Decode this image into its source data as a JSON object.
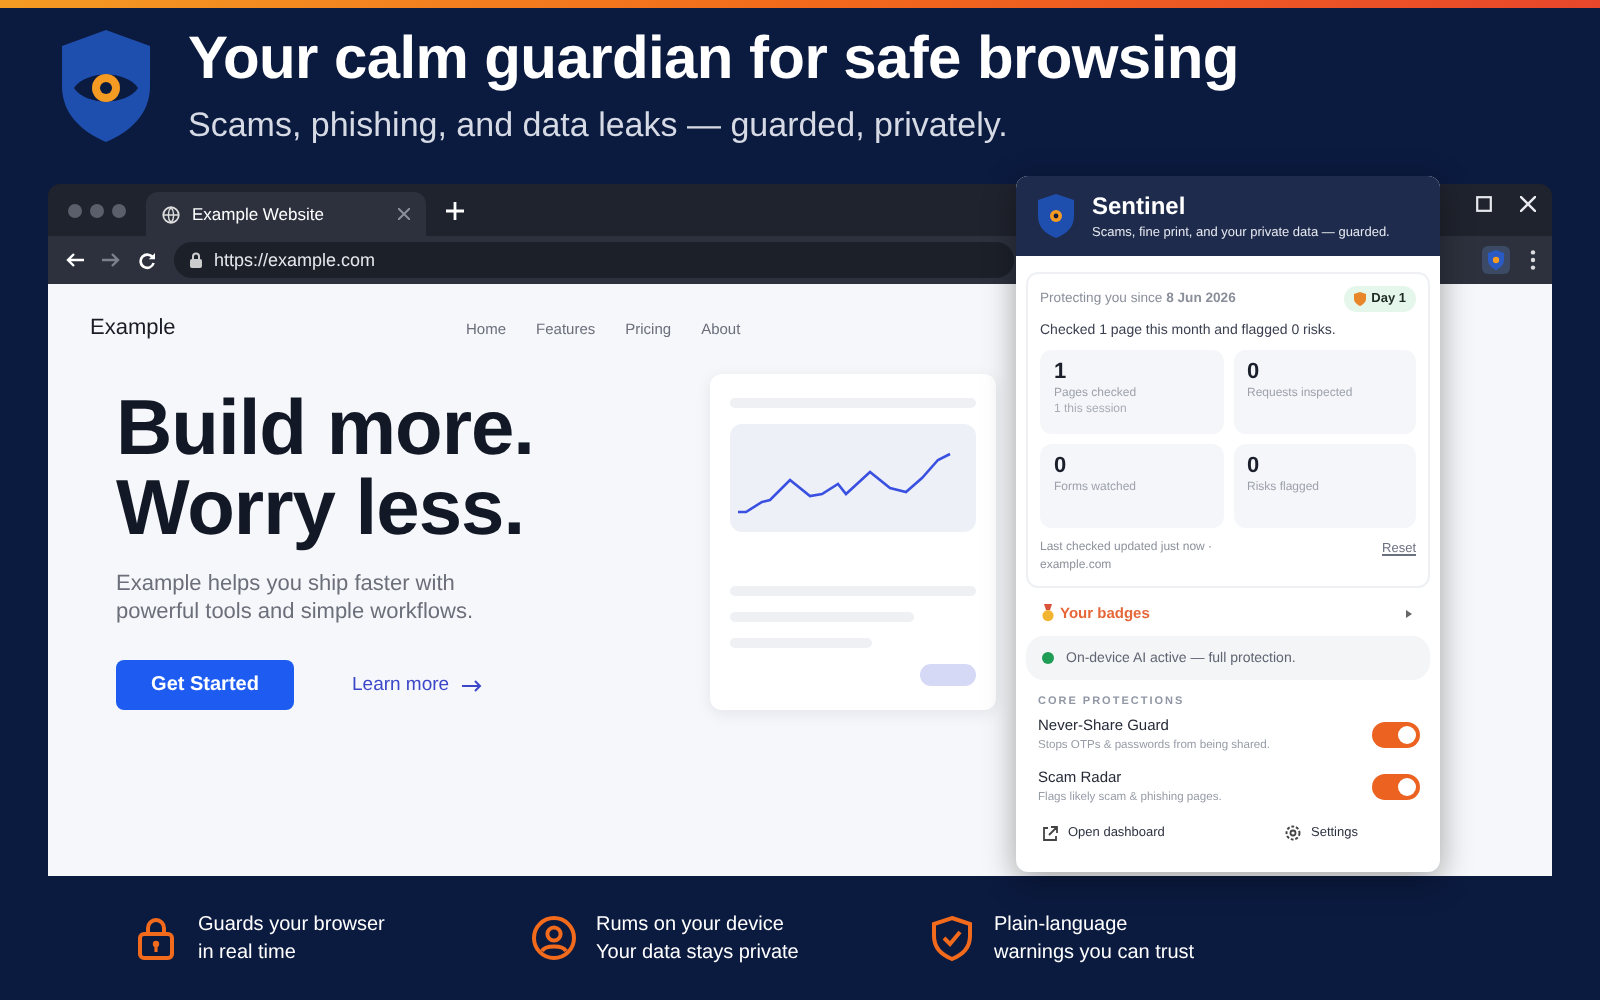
{
  "hero": {
    "title": "Your calm guardian for safe browsing",
    "subtitle": "Scams, phishing, and data leaks — guarded, privately."
  },
  "browser": {
    "tabs": [
      {
        "label": "Example Website",
        "selected": true
      }
    ],
    "url": "https://example.com",
    "site": {
      "logo": "Example",
      "nav": [
        "Home",
        "Features",
        "Pricing",
        "About"
      ],
      "headline": [
        "Build more.",
        "Worry less."
      ],
      "text": "Example helps you ship faster with powerful tools and simple workflows.",
      "primary_button": "Get Started",
      "link": "Learn more"
    }
  },
  "popup": {
    "title": "Sentinel",
    "subtitle": "Scams, fine print, and your private data — guarded.",
    "since": "Protecting you since **8 Jun 2026**",
    "day_badge": "Day 1",
    "summary": "Checked 1 page this month and flagged 0 risks.",
    "stats": [
      {
        "value": "1",
        "label": "Pages checked",
        "note": "1 this session"
      },
      {
        "value": "0",
        "label": "Requests inspected"
      },
      {
        "value": "0",
        "label": "Forms watched"
      },
      {
        "value": "0",
        "label": "Risks flagged"
      }
    ],
    "last_checked": "Last checked updated just now · example.com",
    "reset": "Reset",
    "badges_label": "Your badges",
    "status": "On-device AI active — full protection.",
    "section": "CORE PROTECTIONS",
    "protections": [
      {
        "name": "Never-Share Guard",
        "description": "Stops OTPs & passwords from being shared.",
        "on": true
      },
      {
        "name": "Scam Radar",
        "description": "Flags likely scam & phishing pages.",
        "on": true
      }
    ],
    "footer": [
      {
        "kind": "dashboard",
        "label": "Open dashboard"
      },
      {
        "kind": "settings",
        "label": "Settings"
      }
    ]
  },
  "features": [
    {
      "kind": "lock",
      "title": "Guards your browser",
      "text": "in real time"
    },
    {
      "kind": "person",
      "title": "Rums on your device",
      "text": "Your data stays private"
    },
    {
      "kind": "shield",
      "title": "Plain-language",
      "text": "warnings you can trust"
    }
  ]
}
